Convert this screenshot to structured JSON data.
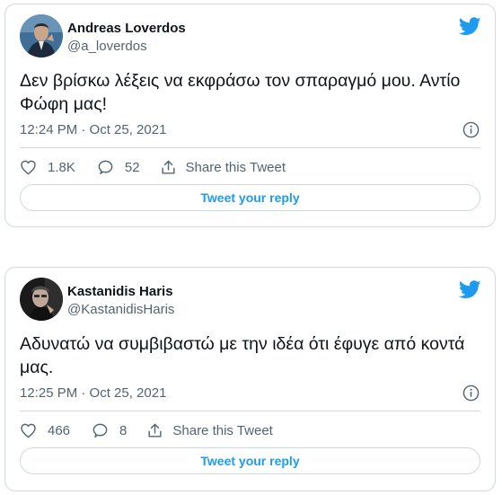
{
  "colors": {
    "text": "#0f1419",
    "secondary": "#536471",
    "border": "#cfd9de",
    "twitter_blue": "#1d9bf0"
  },
  "tweets": [
    {
      "author_name": "Andreas Loverdos",
      "author_handle": "@a_loverdos",
      "avatar": "avatar-photo",
      "text": "Δεν βρίσκω λέξεις να εκφράσω τον σπαραγμό μου. Αντίο Φώφη μας!",
      "timestamp": "12:24 PM · Oct 25, 2021",
      "likes": "1.8K",
      "replies": "52",
      "share_label": "Share this Tweet",
      "reply_button_label": "Tweet your reply",
      "icons": [
        "twitter-bird-icon",
        "info-icon",
        "heart-icon",
        "reply-bubble-icon",
        "share-icon"
      ]
    },
    {
      "author_name": "Kastanidis Haris",
      "author_handle": "@KastanidisHaris",
      "avatar": "avatar-photo",
      "text": "Αδυνατώ να συμβιβαστώ με την ιδέα ότι έφυγε από κοντά μας.",
      "timestamp": "12:25 PM · Oct 25, 2021",
      "likes": "466",
      "replies": "8",
      "share_label": "Share this Tweet",
      "reply_button_label": "Tweet your reply",
      "icons": [
        "twitter-bird-icon",
        "info-icon",
        "heart-icon",
        "reply-bubble-icon",
        "share-icon"
      ]
    }
  ]
}
